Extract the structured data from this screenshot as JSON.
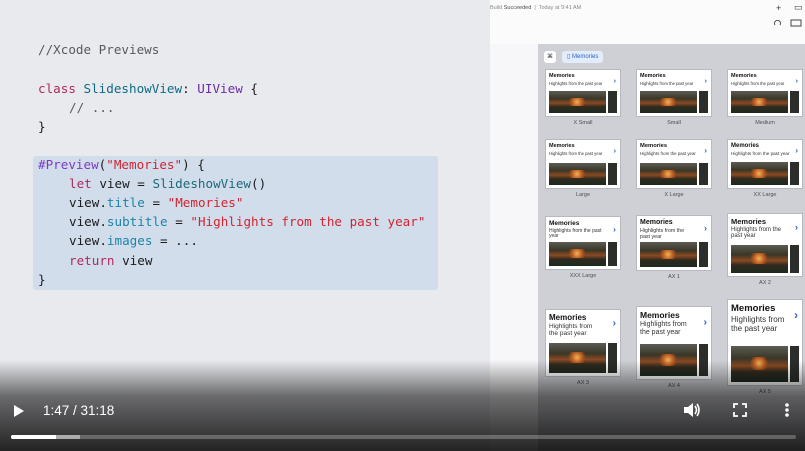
{
  "code": {
    "comment_header": "//Xcode Previews",
    "line_class": {
      "kw": "class",
      "name": "SlideshowView",
      "colon": ":",
      "super": "UIView",
      "brace": "{"
    },
    "line_comment": "// ...",
    "line_close": "}",
    "preview": {
      "macro": "#Preview",
      "open": "(",
      "name": "\"Memories\"",
      "close": ") {",
      "let_kw": "let",
      "let_rest1": "view =",
      "let_type": "SlideshowView",
      "let_rest2": "()",
      "title_obj": "view.",
      "title_prop": "title",
      "title_eq": "=",
      "title_val": "\"Memories\"",
      "subtitle_obj": "view.",
      "subtitle_prop": "subtitle",
      "subtitle_eq": "=",
      "subtitle_val": "\"Highlights from the past year\"",
      "images_obj": "view.",
      "images_prop": "images",
      "images_rest": "= ...",
      "return_kw": "return",
      "return_rest": "view",
      "end": "}"
    }
  },
  "xcode": {
    "status_prefix": "Build",
    "status_state": "Succeeded",
    "status_time": "Today at 9:41 AM",
    "plus_icon": "+",
    "window_icon": "▭",
    "toolbar_tab": "Memories",
    "tiles": [
      {
        "label": "X Small",
        "title": "Memories",
        "subtitle": "Highlights from the past year"
      },
      {
        "label": "Small",
        "title": "Memories",
        "subtitle": "Highlights from the past year"
      },
      {
        "label": "Medium",
        "title": "Memories",
        "subtitle": "Highlights from the past year"
      },
      {
        "label": "Large",
        "title": "Memories",
        "subtitle": "Highlights from the past year"
      },
      {
        "label": "X Large",
        "title": "Memories",
        "subtitle": "Highlights from the past year"
      },
      {
        "label": "XX Large",
        "title": "Memories",
        "subtitle": "Highlights from the past year"
      },
      {
        "label": "XXX Large",
        "title": "Memories",
        "subtitle": "Highlights from the past year"
      },
      {
        "label": "AX 1",
        "title": "Memories",
        "subtitle": "Highlights from the past year"
      },
      {
        "label": "AX 2",
        "title": "Memories",
        "subtitle": "Highlights from the past year"
      },
      {
        "label": "AX 3",
        "title": "Memories",
        "subtitle": "Highlights from the past year"
      },
      {
        "label": "AX 4",
        "title": "Memories",
        "subtitle": "Highlights from the past year"
      },
      {
        "label": "AX 5",
        "title": "Memories",
        "subtitle": "Highlights from the past year"
      }
    ]
  },
  "player": {
    "time": "1:47 / 31:18",
    "progress": 0.057,
    "buffered": 0.088,
    "play_icon": "play-icon",
    "volume_icon": "volume-icon",
    "fullscreen_icon": "fullscreen-icon",
    "more_icon": "more-vertical-icon"
  }
}
